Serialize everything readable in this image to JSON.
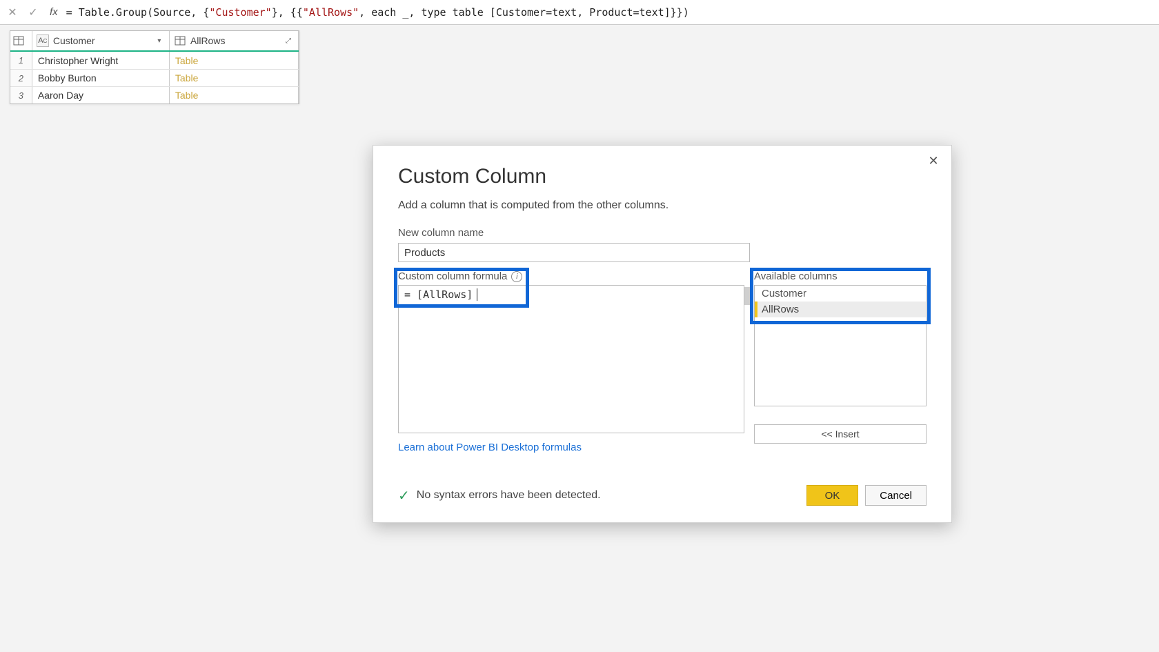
{
  "formula_bar": {
    "fx_label": "fx",
    "formula_prefix": "= Table.Group(Source, {",
    "formula_q1": "\"Customer\"",
    "formula_mid": "}, {{",
    "formula_q2": "\"AllRows\"",
    "formula_mid2": ", each _, type table [Customer=text, Product=text]}})"
  },
  "grid": {
    "cols": {
      "c1": "Customer",
      "c2": "AllRows"
    },
    "rows": [
      {
        "idx": "1",
        "customer": "Christopher Wright",
        "allrows": "Table"
      },
      {
        "idx": "2",
        "customer": "Bobby Burton",
        "allrows": "Table"
      },
      {
        "idx": "3",
        "customer": "Aaron Day",
        "allrows": "Table"
      }
    ]
  },
  "dialog": {
    "title": "Custom Column",
    "description": "Add a column that is computed from the other columns.",
    "new_col_label": "New column name",
    "new_col_value": "Products",
    "formula_label": "Custom column formula",
    "formula_value": "= [AllRows]",
    "avail_label": "Available columns",
    "avail_items": {
      "a0": "Customer",
      "a1": "AllRows"
    },
    "insert_label": "<< Insert",
    "learn_label": "Learn about Power BI Desktop formulas",
    "syntax_msg": "No syntax errors have been detected.",
    "ok_label": "OK",
    "cancel_label": "Cancel"
  }
}
